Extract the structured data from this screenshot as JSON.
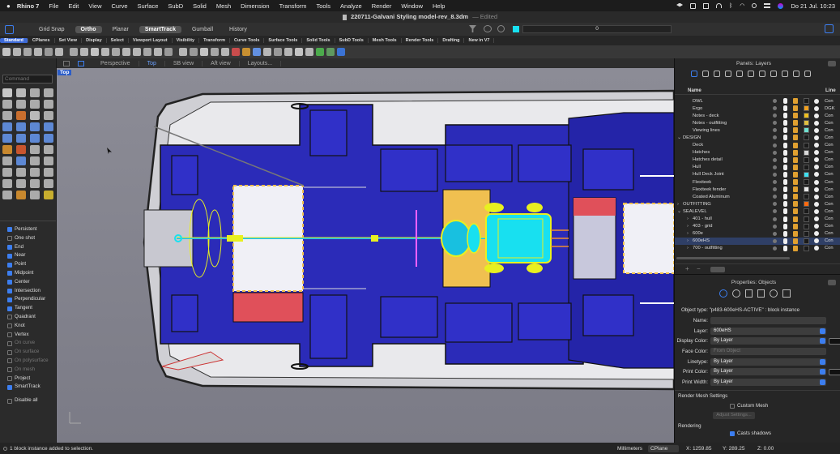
{
  "menubar": {
    "app": "Rhino 7",
    "items": [
      "File",
      "Edit",
      "View",
      "Curve",
      "Surface",
      "SubD",
      "Solid",
      "Mesh",
      "Dimension",
      "Transform",
      "Tools",
      "Analyze",
      "Render",
      "Window",
      "Help"
    ],
    "clock": "Do 21 Jul.  10:23"
  },
  "window": {
    "title": "220711-Galvani Styling model-rev_8.3dm",
    "edited": "— Edited"
  },
  "modes": {
    "items": [
      {
        "label": "Grid Snap",
        "on": false
      },
      {
        "label": "Ortho",
        "on": true
      },
      {
        "label": "Planar",
        "on": false
      },
      {
        "label": "SmartTrack",
        "on": true
      },
      {
        "label": "Gumball",
        "on": false
      },
      {
        "label": "History",
        "on": false
      }
    ],
    "counter": "0"
  },
  "toolbar_tabs": [
    "Standard",
    "CPlanes",
    "Set View",
    "Display",
    "Select",
    "Viewport Layout",
    "Visibility",
    "Transform",
    "Curve Tools",
    "Surface Tools",
    "Solid Tools",
    "SubD Tools",
    "Mesh Tools",
    "Render Tools",
    "Drafting",
    "New in V7"
  ],
  "viewport_tabs": [
    "Perspective",
    "Top",
    "SB view",
    "Aft view",
    "Layouts..."
  ],
  "viewport": {
    "label": "Top"
  },
  "command": {
    "placeholder": "Command"
  },
  "osnaps": [
    {
      "label": "Persistent",
      "on": true
    },
    {
      "label": "One shot",
      "on": false
    },
    {
      "label": "End",
      "on": true
    },
    {
      "label": "Near",
      "on": true
    },
    {
      "label": "Point",
      "on": true
    },
    {
      "label": "Midpoint",
      "on": true
    },
    {
      "label": "Center",
      "on": true
    },
    {
      "label": "Intersection",
      "on": true
    },
    {
      "label": "Perpendicular",
      "on": true
    },
    {
      "label": "Tangent",
      "on": true
    },
    {
      "label": "Quadrant",
      "on": false
    },
    {
      "label": "Knot",
      "on": false
    },
    {
      "label": "Vertex",
      "on": false
    },
    {
      "label": "On curve",
      "on": false
    },
    {
      "label": "On surface",
      "on": false
    },
    {
      "label": "On polysurface",
      "on": false
    },
    {
      "label": "On mesh",
      "on": false
    },
    {
      "label": "Project",
      "on": false
    },
    {
      "label": "SmartTrack",
      "on": true
    },
    {
      "label": "Disable all",
      "on": false
    }
  ],
  "layers_panel": {
    "title": "Panels: Layers",
    "col_name": "Name",
    "col_line": "Line",
    "rows": [
      {
        "name": "DWL",
        "indent": 1,
        "swatch": "#1a1a1a",
        "line": "Con"
      },
      {
        "name": "Ergo",
        "indent": 1,
        "swatch": "#f0a020",
        "line": "DGK"
      },
      {
        "name": "Notes - deck",
        "indent": 1,
        "swatch": "#f0c020",
        "line": "Con"
      },
      {
        "name": "Notes - outfitting",
        "indent": 1,
        "swatch": "#e0c040",
        "line": "Con"
      },
      {
        "name": "Viewing lines",
        "indent": 1,
        "swatch": "#70e0d0",
        "line": "Con"
      },
      {
        "name": "DESIGN",
        "indent": 0,
        "swatch": "#1a1a1a",
        "line": "Con",
        "arrow": "⌄"
      },
      {
        "name": "Deck",
        "indent": 1,
        "swatch": "#1a1a1a",
        "line": "Con"
      },
      {
        "name": "Hatches",
        "indent": 1,
        "swatch": "#d8d8d8",
        "line": "Con"
      },
      {
        "name": "Hatches detail",
        "indent": 1,
        "swatch": "#1a1a1a",
        "line": "Con"
      },
      {
        "name": "Hull",
        "indent": 1,
        "swatch": "#1a1a1a",
        "line": "Con"
      },
      {
        "name": "Hull Deck Joint",
        "indent": 1,
        "swatch": "#40e0f0",
        "line": "Con"
      },
      {
        "name": "Flexiteek",
        "indent": 1,
        "swatch": "#1a1a1a",
        "line": "Con"
      },
      {
        "name": "Flexiteek fender",
        "indent": 1,
        "swatch": "#e8e8e8",
        "line": "Con"
      },
      {
        "name": "Coated Aluminum",
        "indent": 1,
        "swatch": "#1a1a1a",
        "line": "Con"
      },
      {
        "name": "OUTFITTING",
        "indent": 0,
        "swatch": "#ff6a10",
        "line": "Con",
        "arrow": "›"
      },
      {
        "name": "SEALEVEL",
        "indent": 0,
        "swatch": "#1a1a1a",
        "line": "Con",
        "arrow": "⌄"
      },
      {
        "name": "401 - hull",
        "indent": 1,
        "swatch": "#1a1a1a",
        "line": "Con",
        "arrow": "›"
      },
      {
        "name": "403 - grid",
        "indent": 1,
        "swatch": "#1a1a1a",
        "line": "Con",
        "arrow": "›"
      },
      {
        "name": "600e",
        "indent": 1,
        "swatch": "#1a1a1a",
        "line": "Con",
        "arrow": "›"
      },
      {
        "name": "600eHS",
        "indent": 1,
        "swatch": "#1a1a1a",
        "line": "Con",
        "arrow": "›"
      },
      {
        "name": "700 - outfitting",
        "indent": 1,
        "swatch": "#1a1a1a",
        "line": "Con",
        "arrow": "›"
      }
    ]
  },
  "properties_panel": {
    "title": "Properties: Objects",
    "object_type": "Object type:  \"p483-600eHS-ACTIVE\" : block instance",
    "fields": [
      {
        "label": "Name:",
        "value": "",
        "disabled": false,
        "caret": false
      },
      {
        "label": "Layer:",
        "value": "600eHS",
        "disabled": false,
        "caret": true
      },
      {
        "label": "Display Color:",
        "value": "By Layer",
        "disabled": false,
        "caret": true
      },
      {
        "label": "Face Color:",
        "value": "From Object",
        "disabled": true,
        "caret": false
      },
      {
        "label": "Linetype:",
        "value": "By Layer",
        "disabled": false,
        "caret": true
      },
      {
        "label": "Print Color:",
        "value": "By Layer",
        "disabled": false,
        "caret": true
      },
      {
        "label": "Print Width:",
        "value": "By Layer",
        "disabled": false,
        "caret": true
      }
    ],
    "render_mesh_heading": "Render Mesh Settings",
    "custom_mesh": "Custom Mesh",
    "adjust_settings": "Adjust Settings...",
    "rendering_heading": "Rendering",
    "casts_shadows": "Casts shadows"
  },
  "status": {
    "message": "1 block instance added to selection.",
    "units": "Millimeters",
    "cplane": "CPlane",
    "x": "X: 1259.85",
    "y": "Y: 289.25",
    "z": "Z: 0.00"
  },
  "colors": {
    "accent": "#3c7ef0",
    "deck_blue": "#2b2bb8",
    "hatch_red": "#e0505a",
    "hatch_orange": "#f0c050",
    "engine_cyan": "#18e0f0",
    "engine_yellow": "#e8f020"
  }
}
